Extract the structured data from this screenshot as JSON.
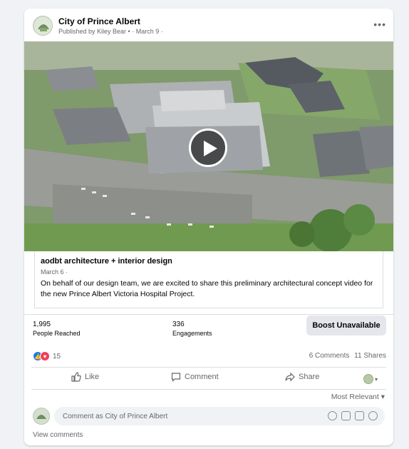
{
  "post": {
    "page_name": "City of Prince Albert",
    "byline": "Published by Kiley Bear • · March 9 ·",
    "more_label": "•••"
  },
  "shared": {
    "title": "aodbt architecture + interior design",
    "date": "March 6 ·",
    "text": "On behalf of our design team, we are excited to share this preliminary architectural concept video for the new Prince Albert Victoria Hospital Project."
  },
  "insights": {
    "reached_value": "1,995",
    "reached_label": "People Reached",
    "engagements_value": "336",
    "engagements_label": "Engagements",
    "boost_label": "Boost Unavailable"
  },
  "counts": {
    "reactions": "15",
    "comments": "6 Comments",
    "shares": "11 Shares"
  },
  "actions": {
    "like": "Like",
    "comment": "Comment",
    "share": "Share"
  },
  "sort_label": "Most Relevant ▾",
  "comment_box": {
    "placeholder": "Comment as City of Prince Albert"
  },
  "view_comments": "View comments",
  "icons": {
    "play": "play-icon",
    "like": "thumbs-up-icon",
    "comment": "speech-bubble-icon",
    "share": "share-arrow-icon",
    "emoji": "emoji-icon",
    "camera": "camera-icon",
    "gif": "gif-icon",
    "sticker": "sticker-icon"
  },
  "colors": {
    "brand_blue": "#1877f2",
    "love_red": "#f33e58",
    "secondary_text": "#65676b"
  }
}
